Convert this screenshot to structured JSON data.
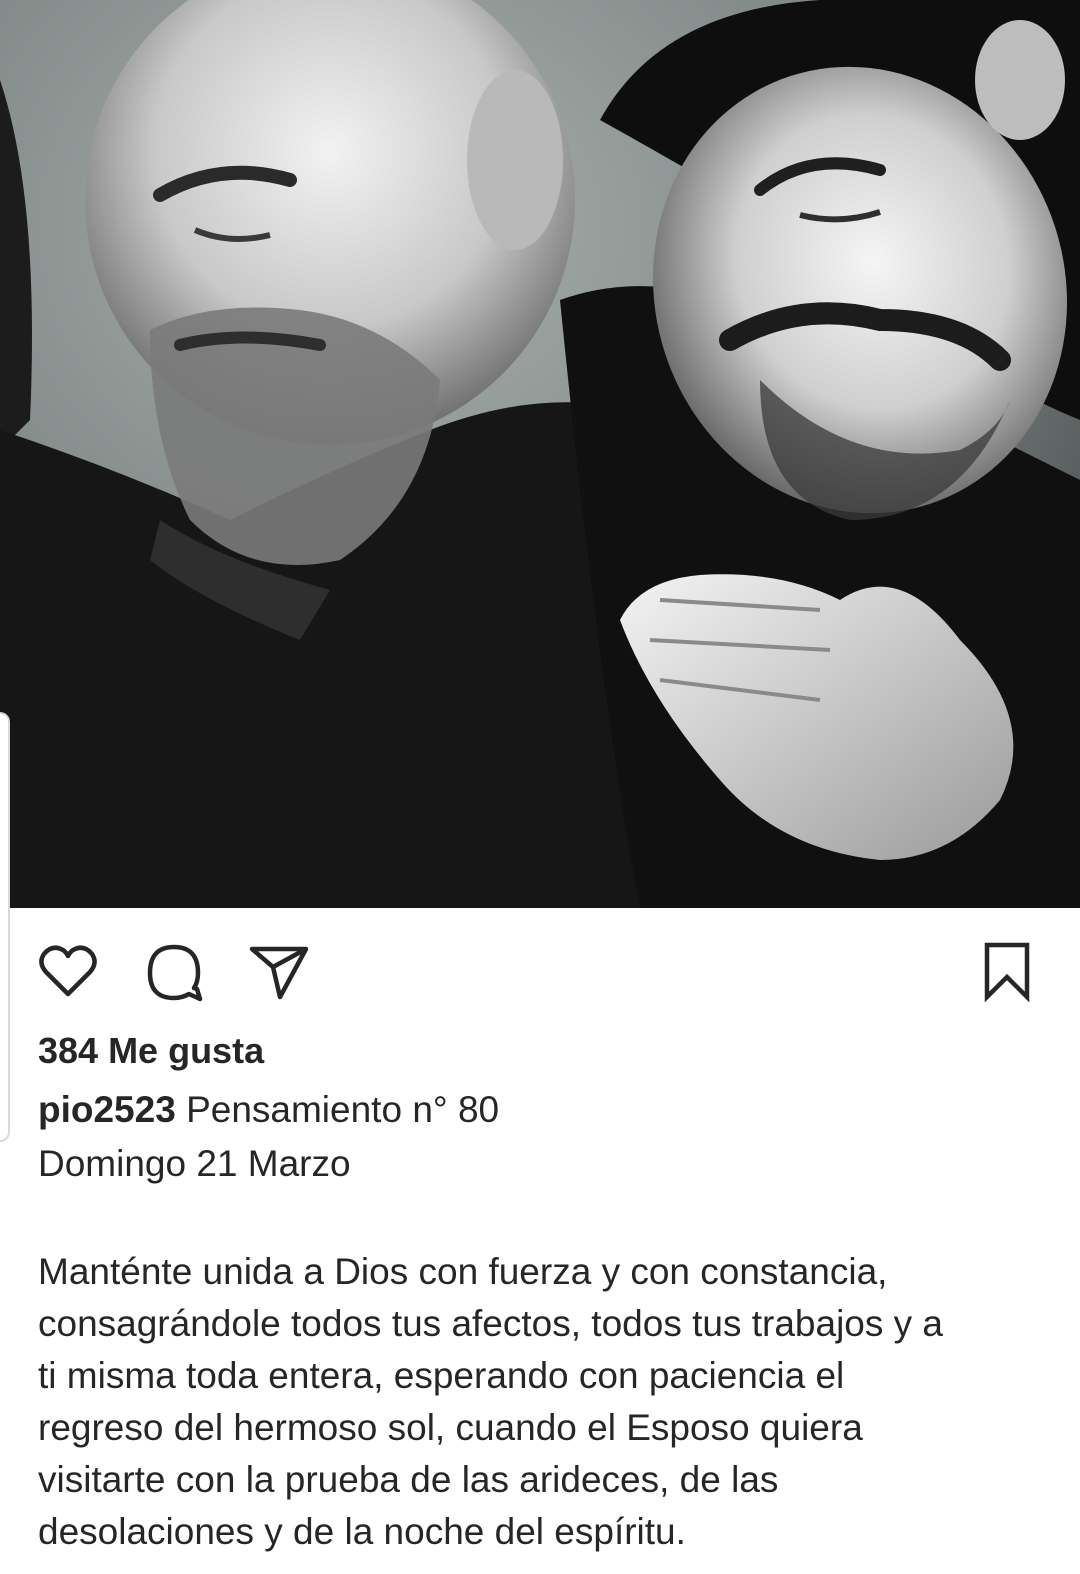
{
  "post": {
    "image_alt": "Black and white photo of two friars, one resting his head on the other's shoulder",
    "likes_label": "384 Me gusta",
    "username": "pio2523",
    "caption_title": "Pensamiento n° 80",
    "caption_date": "Domingo 21 Marzo",
    "caption_lines": [
      "Manténte unida a Dios con fuerza y con constancia,",
      "consagrándole todos tus afectos, todos tus trabajos y a",
      "ti misma toda entera, esperando con paciencia el",
      "regreso del hermoso sol, cuando el Esposo quiera",
      "visitarte con la prueba de las arideces, de las",
      "desolaciones y de la noche del espíritu."
    ]
  },
  "actions": {
    "like_icon": "heart-outline-icon",
    "comment_icon": "speech-bubble-icon",
    "share_icon": "paper-plane-icon",
    "save_icon": "bookmark-outline-icon"
  },
  "colors": {
    "text": "#262626",
    "background": "#ffffff"
  }
}
